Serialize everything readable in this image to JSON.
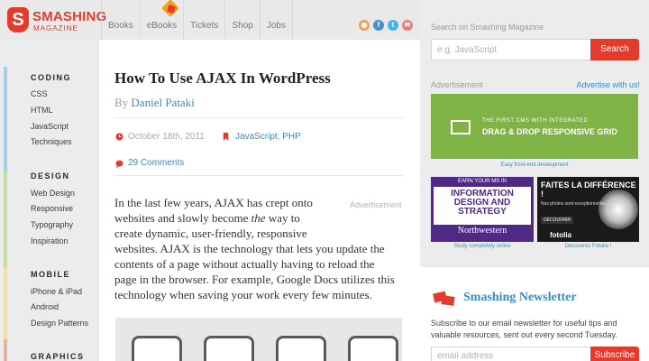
{
  "brand": {
    "name": "SMASHING",
    "sub": "MAGAZINE",
    "letter": "S"
  },
  "nav": [
    "Books",
    "eBooks",
    "Tickets",
    "Shop",
    "Jobs"
  ],
  "social": [
    {
      "icon": "rss-icon",
      "glyph": "◉",
      "color": "#f0a04b"
    },
    {
      "icon": "facebook-icon",
      "glyph": "f",
      "color": "#4a8fc9"
    },
    {
      "icon": "twitter-icon",
      "glyph": "t",
      "color": "#4ab3e6"
    },
    {
      "icon": "email-icon",
      "glyph": "✉",
      "color": "#e77b7b"
    }
  ],
  "sidebar": {
    "groups": [
      {
        "title": "CODING",
        "color": "#a6cee8",
        "items": [
          "CSS",
          "HTML",
          "JavaScript",
          "Techniques"
        ]
      },
      {
        "title": "DESIGN",
        "color": "#c6dea1",
        "items": [
          "Web Design",
          "Responsive",
          "Typography",
          "Inspiration"
        ]
      },
      {
        "title": "MOBILE",
        "color": "#f0e29a",
        "items": [
          "iPhone & iPad",
          "Android",
          "Design Patterns"
        ]
      },
      {
        "title": "GRAPHICS",
        "color": "#e6b0a8",
        "items": []
      }
    ]
  },
  "article": {
    "title": "How To Use AJAX In WordPress",
    "by": "By",
    "author": "Daniel Pataki",
    "date": "October 18th, 2011",
    "tags": "JavaScript, PHP",
    "comments": "29 Comments",
    "ad_label": "Advertisement",
    "body_lines": [
      "In the last few years, AJAX has crept onto",
      "websites and slowly become the way to",
      "create dynamic, user-friendly, responsive",
      "websites. AJAX is the technology that lets you update the",
      "contents of a page without actually having to reload the",
      "page in the browser. For example, Google Docs utilizes this",
      "technology when saving your work every few minutes."
    ]
  },
  "right": {
    "search_label": "Search on Smashing Magazine",
    "search_placeholder": "e.g. JavaScript",
    "search_button": "Search",
    "ad_label": "Advertisement",
    "advertise_link": "Advertise with us!",
    "banner_cms": {
      "small": "THE FIRST CMS WITH INTEGRATED",
      "big": "DRAG & DROP RESPONSIVE GRID",
      "caption": "Easy front-end development"
    },
    "banner_nw": {
      "top": "EARN YOUR MS IN",
      "mid": "INFORMATION DESIGN AND STRATEGY",
      "bot": "Northwestern",
      "caption": "Study completely online"
    },
    "banner_fotolia": {
      "headline": "FAITES LA DIFFÉRENCE !",
      "sub": "Nos photos sont exceptionnelles !",
      "btn": "DÉCOUVRIR",
      "brand": "fotolia",
      "caption": "Découvrez Fotolia !"
    },
    "newsletter": {
      "title": "Smashing Newsletter",
      "text": "Subscribe to our email newsletter for useful tips and valuable resources, sent out every second Tuesday.",
      "placeholder": "email address",
      "button": "Subscribe"
    }
  }
}
